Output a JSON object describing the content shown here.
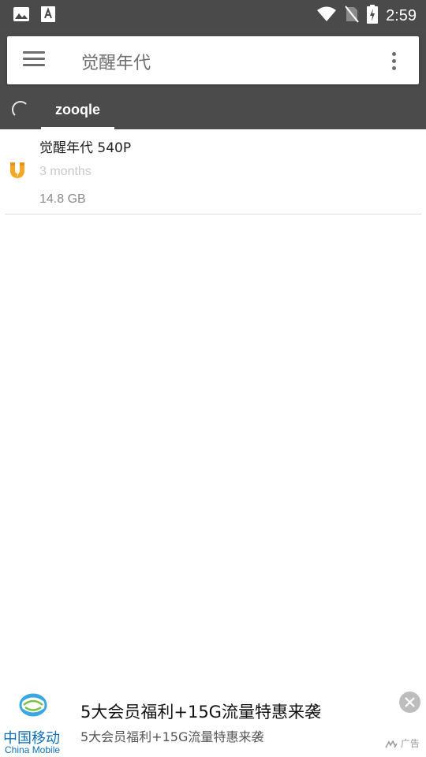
{
  "status_bar": {
    "time": "2:59",
    "icons": [
      "image-icon",
      "text-a-icon",
      "wifi-icon",
      "no-sim-icon",
      "battery-charging-icon"
    ]
  },
  "search": {
    "query": "觉醒年代"
  },
  "tabs": [
    {
      "label": "zooqle",
      "selected": true
    }
  ],
  "results": [
    {
      "title": "觉醒年代 540P",
      "age": "3 months",
      "size": "14.8 GB",
      "icon": "magnet-icon"
    }
  ],
  "ad": {
    "brand_cn": "中国移动",
    "brand_en": "China Mobile",
    "title": "5大会员福利+15G流量特惠来袭",
    "subtitle": "5大会员福利+15G流量特惠来袭",
    "badge": "广告"
  },
  "colors": {
    "toolbar": "#4b4b4b",
    "magnet_orange": "#f5a623",
    "china_mobile_blue": "#0f6fb4"
  }
}
